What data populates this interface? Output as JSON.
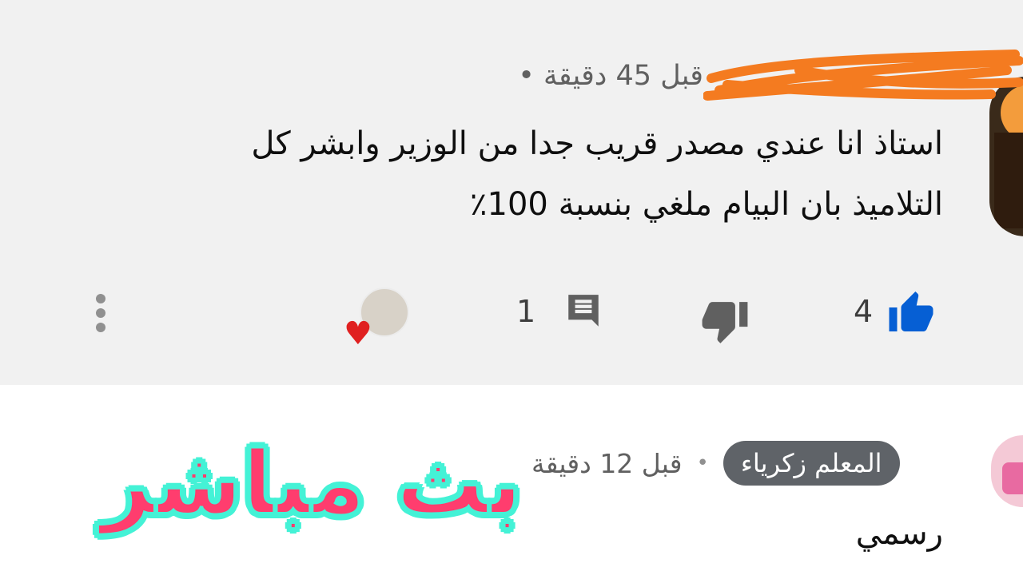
{
  "comment": {
    "time": "قبل 45 دقيقة",
    "separator": "•",
    "text_line1": "استاذ انا عندي مصدر قريب جدا من الوزير وابشر كل",
    "text_line2": "التلاميذ بان البيام ملغي بنسبة 100٪",
    "like_count": "4",
    "reply_count": "1",
    "accent_color": "#065fd4",
    "scribble_color": "#f47b20"
  },
  "reply": {
    "author": "المعلم زكرياء",
    "separator": "•",
    "time": "قبل 12 دقيقة",
    "text": "رسمي"
  },
  "overlay": {
    "title": "بث مباشر",
    "fill_color": "#ff3d6e",
    "outline_color": "#44f2d6"
  }
}
